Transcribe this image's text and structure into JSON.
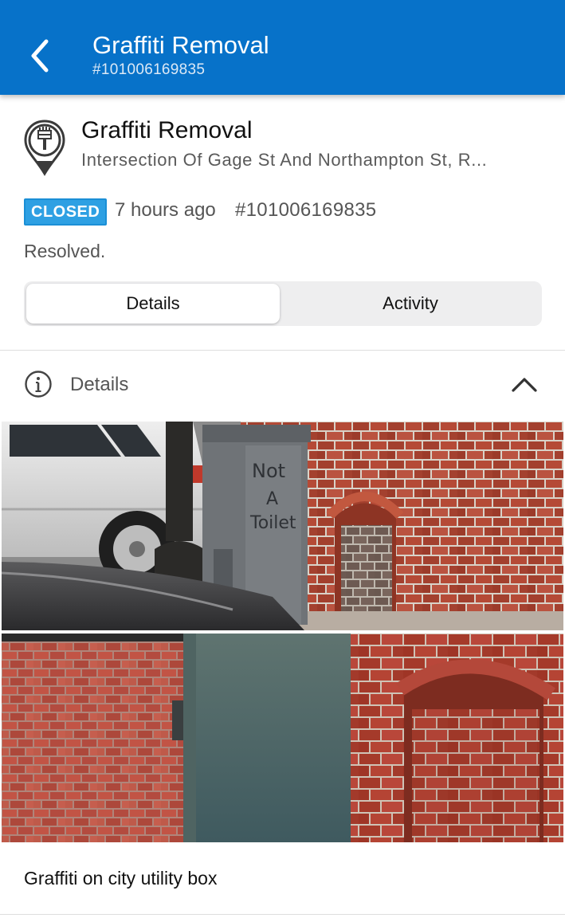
{
  "app_bar": {
    "title": "Graffiti Removal",
    "subtitle": "#101006169835",
    "back_icon": "chevron-left-icon",
    "background_color": "#0772c9"
  },
  "request": {
    "title": "Graffiti Removal",
    "address": "Intersection Of Gage St And Northampton St, R...",
    "category_icon": "graffiti-brush-pin-icon",
    "status_badge": "CLOSED",
    "status_color": "#2ea0e3",
    "time_ago": "7 hours ago",
    "request_id": "#101006169835",
    "resolution": "Resolved."
  },
  "tabs": [
    {
      "label": "Details",
      "selected": true
    },
    {
      "label": "Activity",
      "selected": false
    }
  ],
  "details_section": {
    "label": "Details",
    "icon": "info-icon",
    "toggle_icon": "chevron-up-icon",
    "expanded": true
  },
  "photos": [
    {
      "content": "graffiti-on-utility-box-photo",
      "graffiti_text": "Not A Toilet"
    },
    {
      "content": "utility-box-close-up-photo"
    }
  ],
  "description": "Graffiti on city utility box"
}
